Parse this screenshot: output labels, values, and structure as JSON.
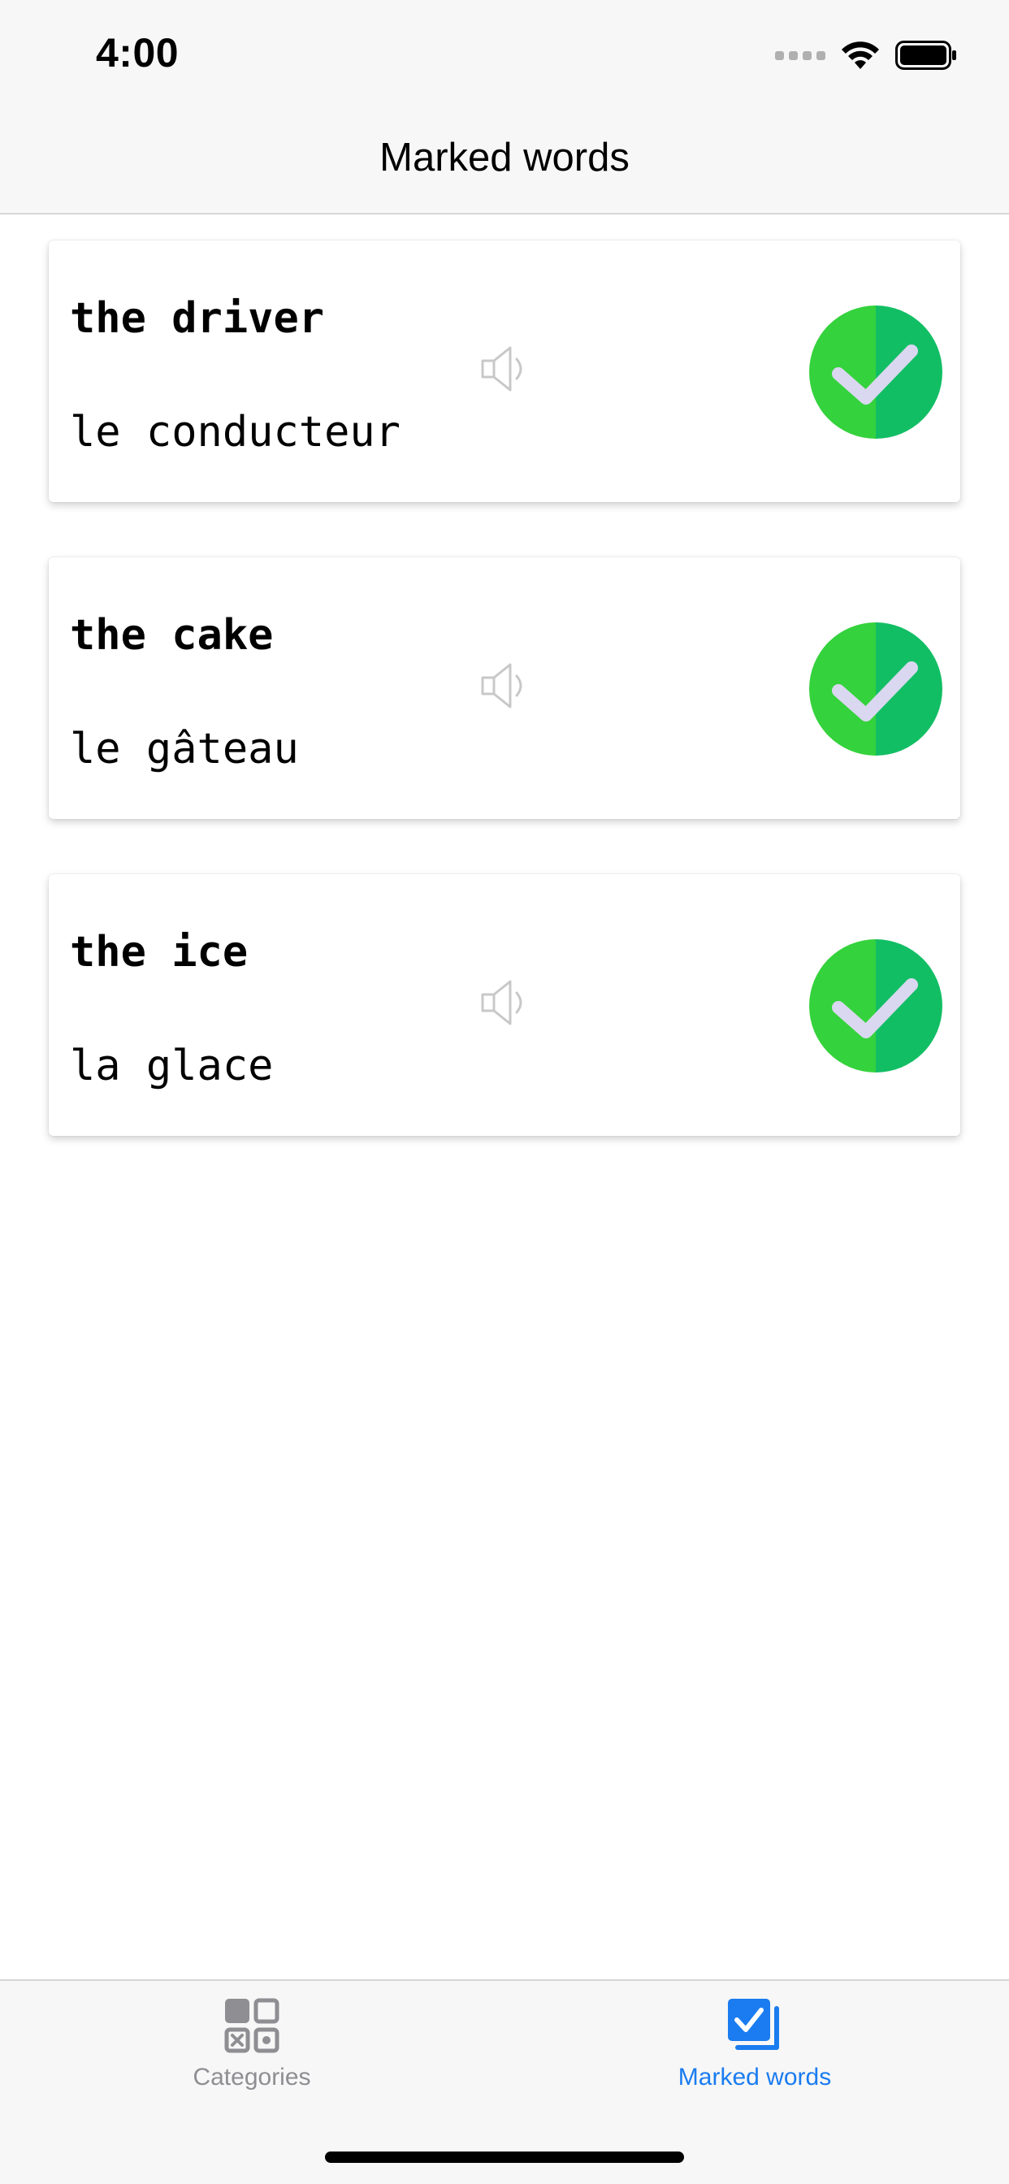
{
  "status_bar": {
    "time": "4:00"
  },
  "nav": {
    "title": "Marked words"
  },
  "cards": [
    {
      "english": "the driver",
      "french": "le conducteur",
      "marked": true
    },
    {
      "english": "the cake",
      "french": "le gâteau",
      "marked": true
    },
    {
      "english": "the ice",
      "french": "la glace",
      "marked": true
    }
  ],
  "icons": {
    "speaker": "speaker-icon",
    "check": "checkmark-circle-icon",
    "categories": "grid-icon",
    "marked": "checkbox-stack-icon"
  },
  "tabbar": {
    "tabs": [
      {
        "label": "Categories",
        "active": false
      },
      {
        "label": "Marked words",
        "active": true
      }
    ]
  },
  "colors": {
    "check_green_light": "#34d23c",
    "check_green_dark": "#12be64",
    "check_mark": "#d9d8f0",
    "tab_active": "#1a7cf0",
    "tab_inactive": "#8e8e93"
  }
}
